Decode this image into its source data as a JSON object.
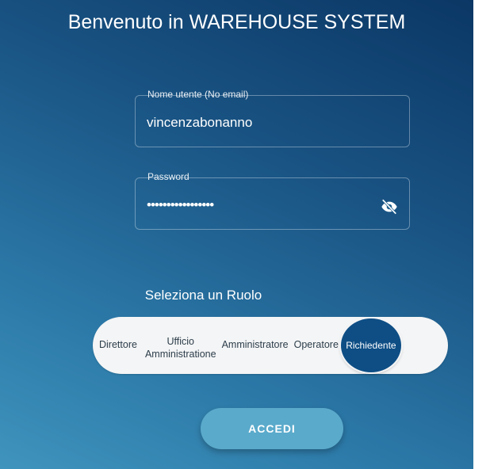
{
  "header": {
    "title": "Benvenuto in WAREHOUSE SYSTEM"
  },
  "form": {
    "username": {
      "label": "Nome utente (No email)",
      "value": "vincenzabonanno"
    },
    "password": {
      "label": "Password",
      "value": "•••••••••••••••••",
      "toggle_icon": "eye-off-icon"
    }
  },
  "roles": {
    "heading": "Seleziona un Ruolo",
    "options": [
      {
        "label_line1": "Direttore",
        "label_line2": ""
      },
      {
        "label_line1": "Ufficio",
        "label_line2": "Amministratione"
      },
      {
        "label_line1": "Amministratore",
        "label_line2": ""
      },
      {
        "label_line1": "Operatore",
        "label_line2": ""
      },
      {
        "label_line1": "Richiedente",
        "label_line2": ""
      }
    ],
    "selected": "Richiedente"
  },
  "actions": {
    "login_label": "ACCEDI"
  },
  "colors": {
    "background_dark": "#0b3765",
    "background_light": "#3f94bd",
    "active_role": "#0e4e85",
    "button": "#5aaacb"
  }
}
